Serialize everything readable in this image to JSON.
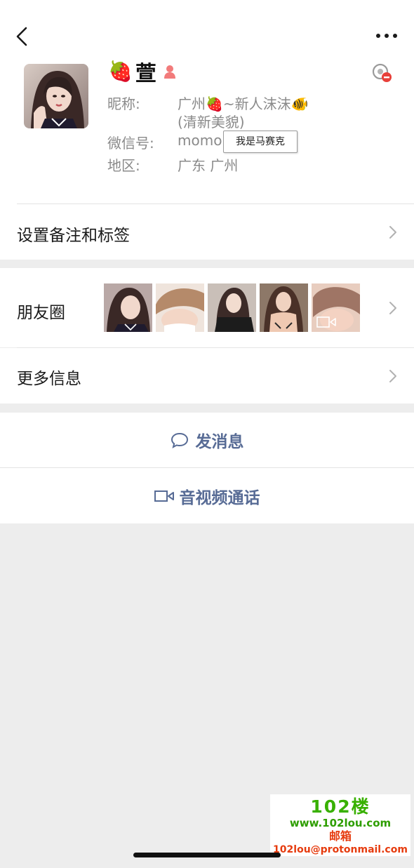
{
  "colors": {
    "background": "#ededed",
    "card": "#ffffff",
    "link_blue": "#576b95",
    "label_gray": "#8a8a8a",
    "watermark_green": "#38b000",
    "watermark_red": "#e63b0e"
  },
  "nav": {
    "back_icon": "chevron-left-icon",
    "more_icon": "more-dots-icon"
  },
  "profile": {
    "name_emoji": "🍓",
    "name": "萱",
    "gender_icon": "female-person-icon",
    "block_icon": "blocked-icon",
    "nickname_label": "昵称:",
    "nickname_line1": "广州🍓~新人沫沫🐠",
    "nickname_line2": "(清新美貌)",
    "wechat_id_label": "微信号:",
    "wechat_id_value": "momo",
    "region_label": "地区:",
    "region_value": "广东  广州",
    "tooltip": "我是马赛克"
  },
  "menu": {
    "remark_tags": "设置备注和标签",
    "moments": "朋友圈",
    "more_info": "更多信息"
  },
  "actions": {
    "send_message": "发消息",
    "send_message_icon": "chat-bubble-icon",
    "video_call": "音视频通话",
    "video_call_icon": "video-camera-icon"
  },
  "watermark": {
    "logo": "102楼",
    "site": "www.102lou.com",
    "mailbox": "邮箱",
    "email": "102lou@protonmail.com"
  }
}
